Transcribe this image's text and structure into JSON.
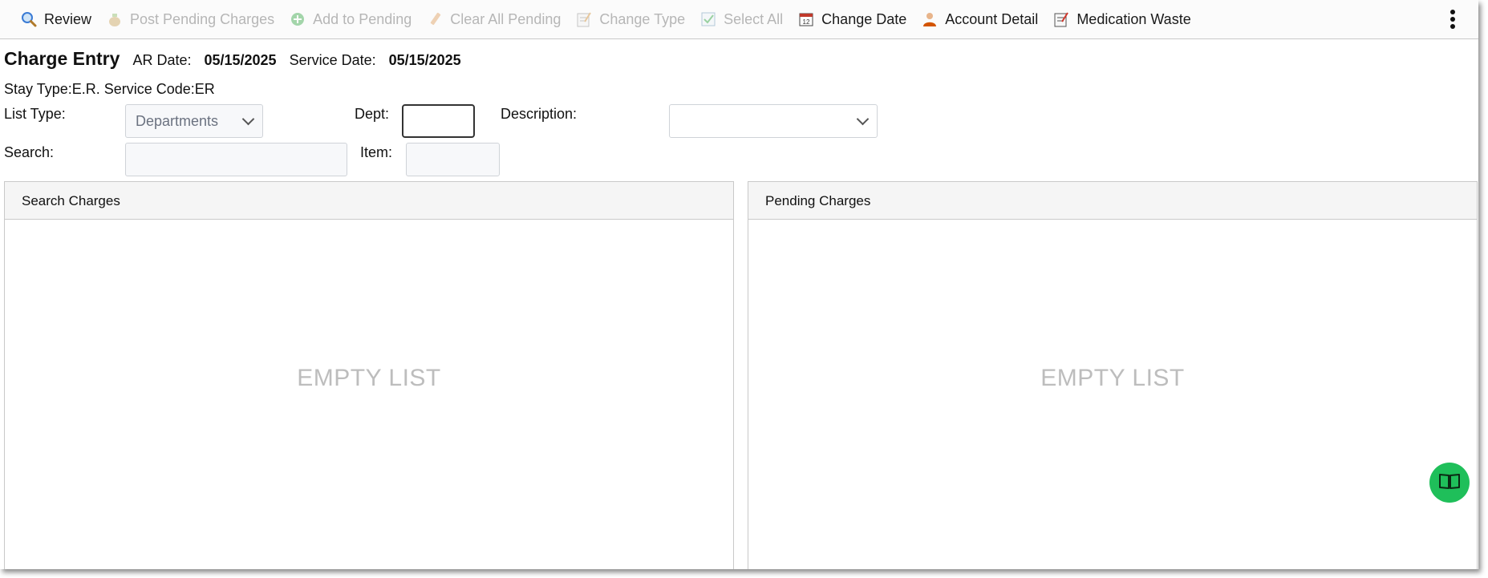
{
  "toolbar": {
    "items": [
      {
        "label": "Review",
        "icon": "magnifier-icon",
        "enabled": true
      },
      {
        "label": "Post Pending Charges",
        "icon": "money-bag-icon",
        "enabled": false
      },
      {
        "label": "Add to Pending",
        "icon": "add-circle-icon",
        "enabled": false
      },
      {
        "label": "Clear All Pending",
        "icon": "eraser-icon",
        "enabled": false
      },
      {
        "label": "Change Type",
        "icon": "edit-note-icon",
        "enabled": false
      },
      {
        "label": "Select All",
        "icon": "checkbox-icon",
        "enabled": false
      },
      {
        "label": "Change Date",
        "icon": "calendar-icon",
        "enabled": true
      },
      {
        "label": "Account Detail",
        "icon": "user-icon",
        "enabled": true
      },
      {
        "label": "Medication Waste",
        "icon": "edit-note-icon",
        "enabled": true
      }
    ],
    "more_icon": "kebab-menu-icon"
  },
  "header": {
    "title": "Charge Entry",
    "ar_date_label": "AR Date:",
    "ar_date": "05/15/2025",
    "service_date_label": "Service Date:",
    "service_date": "05/15/2025",
    "stay_line": "Stay Type:E.R. Service Code:ER"
  },
  "form": {
    "list_type_label": "List Type:",
    "list_type_value": "Departments",
    "dept_label": "Dept:",
    "dept_value": "",
    "description_label": "Description:",
    "description_value": "",
    "search_label": "Search:",
    "search_value": "",
    "item_label": "Item:",
    "item_value": ""
  },
  "panels": {
    "search": {
      "title": "Search Charges",
      "empty_text": "EMPTY LIST"
    },
    "pending": {
      "title": "Pending Charges",
      "empty_text": "EMPTY LIST"
    }
  },
  "fab": {
    "icon": "book-icon",
    "color": "#1fbf5a"
  }
}
